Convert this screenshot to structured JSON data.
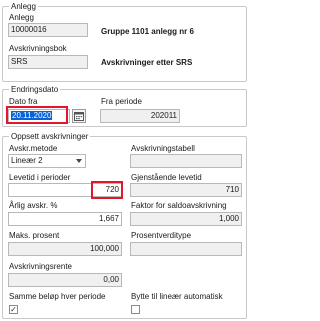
{
  "anlegg": {
    "legend": "Anlegg",
    "id_value": "10000016",
    "name": "Gruppe 1101 anlegg nr 6",
    "avskrivningsbok_label": "Avskrivningsbok",
    "avskrivningsbok_value": "SRS",
    "avskrivningsbok_name": "Avskrivninger etter SRS"
  },
  "endringsdato": {
    "legend": "Endringsdato",
    "dato_fra_label": "Dato fra",
    "dato_fra_value": "20.11.2020",
    "fra_periode_label": "Fra periode",
    "fra_periode_value": "202011"
  },
  "oppsett": {
    "legend": "Oppsett avskrivninger",
    "metode_label": "Avskr.metode",
    "metode_value": "Lineær 2",
    "tabell_label": "Avskrivningstabell",
    "tabell_value": "",
    "levetid_label": "Levetid i perioder",
    "levetid_value": "720",
    "gjenstaende_label": "Gjenstående levetid",
    "gjenstaende_value": "710",
    "arlig_label": "Årlig avskr. %",
    "arlig_value": "1,667",
    "faktor_label": "Faktor for saldoavskrivning",
    "faktor_value": "1,000",
    "maks_label": "Maks. prosent",
    "maks_value": "100,000",
    "prosentverdi_label": "Prosentverditype",
    "prosentverdi_value": "",
    "rente_label": "Avskrivningsrente",
    "rente_value": "0,00",
    "samme_label": "Samme beløp hver periode",
    "samme_checked": "✓",
    "bytte_label": "Bytte til lineær automatisk",
    "bytte_checked": ""
  },
  "colors": {
    "highlight": "#e0182d",
    "selection": "#0a64d6"
  }
}
